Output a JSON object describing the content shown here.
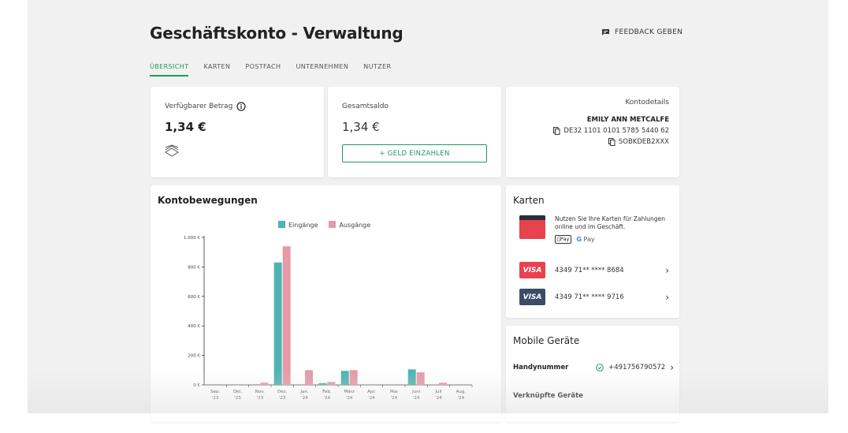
{
  "header": {
    "title": "Geschäftskonto - Verwaltung",
    "feedback_label": "FEEDBACK GEBEN"
  },
  "tabs": [
    {
      "label": "ÜBERSICHT",
      "active": true
    },
    {
      "label": "KARTEN"
    },
    {
      "label": "POSTFACH"
    },
    {
      "label": "UNTERNEHMEN"
    },
    {
      "label": "NUTZER"
    }
  ],
  "available": {
    "label": "Verfügbarer Betrag",
    "amount": "1,34 €",
    "icon": "money-stack-icon"
  },
  "balance": {
    "label": "Gesamtsaldo",
    "amount": "1,34 €",
    "deposit_button": "+ GELD EINZAHLEN"
  },
  "account_details": {
    "title": "Kontodetails",
    "holder": "EMILY ANN METCALFE",
    "iban": "DE32 1101 0101 5785 5440 62",
    "bic": "SOBKDEB2XXX"
  },
  "transactions": {
    "title": "Kontobewegungen"
  },
  "chart_data": {
    "type": "bar",
    "categories": [
      "Sep. '23",
      "Okt. '23",
      "Nov. '23",
      "Dez. '23",
      "Jan. '24",
      "Feb. '24",
      "März '24",
      "Apr. '24",
      "Mai '24",
      "Juni '24",
      "Juli '24",
      "Aug. '24"
    ],
    "category_lines": [
      [
        "Sep.",
        "'23"
      ],
      [
        "Okt.",
        "'23"
      ],
      [
        "Nov.",
        "'23"
      ],
      [
        "Dez.",
        "'23"
      ],
      [
        "Jan.",
        "'24"
      ],
      [
        "Feb.",
        "'24"
      ],
      [
        "März",
        "'24"
      ],
      [
        "Apr.",
        "'24"
      ],
      [
        "Mai",
        "'24"
      ],
      [
        "Juni",
        "'24"
      ],
      [
        "Juli",
        "'24"
      ],
      [
        "Aug.",
        "'24"
      ]
    ],
    "series": [
      {
        "name": "Eingänge",
        "color": "#4fb3b3",
        "values": [
          0,
          0,
          0,
          830,
          0,
          12,
          95,
          0,
          0,
          105,
          0,
          0
        ]
      },
      {
        "name": "Ausgänge",
        "color": "#e49aa8",
        "values": [
          0,
          0,
          15,
          940,
          100,
          20,
          100,
          0,
          0,
          85,
          15,
          0
        ]
      }
    ],
    "yticks": [
      0,
      200,
      400,
      600,
      800,
      1000
    ],
    "ytick_labels": [
      "0 €",
      "200 €",
      "400 €",
      "600 €",
      "800 €",
      "1.000 €"
    ],
    "ylim": [
      0,
      1000
    ],
    "legend": "top-center"
  },
  "cards": {
    "title": "Karten",
    "promo_text": "Nutzen Sie Ihre Karten für Zahlungen online und im Geschäft.",
    "apple_pay": "Pay",
    "google_pay": "Pay",
    "items": [
      {
        "number": "4349 71** **** 8684",
        "brand": "VISA",
        "color": "#e8424f"
      },
      {
        "number": "4349 71** **** 9716",
        "brand": "VISA",
        "color": "#3e4b66"
      }
    ]
  },
  "mobile": {
    "title": "Mobile Geräte",
    "phone_label": "Handynummer",
    "phone_value": "+491756790572",
    "linked_label": "Verknüpfte Geräte"
  },
  "colors": {
    "accent": "#1e9a5c",
    "teal": "#4fb3b3",
    "pink": "#e49aa8"
  }
}
